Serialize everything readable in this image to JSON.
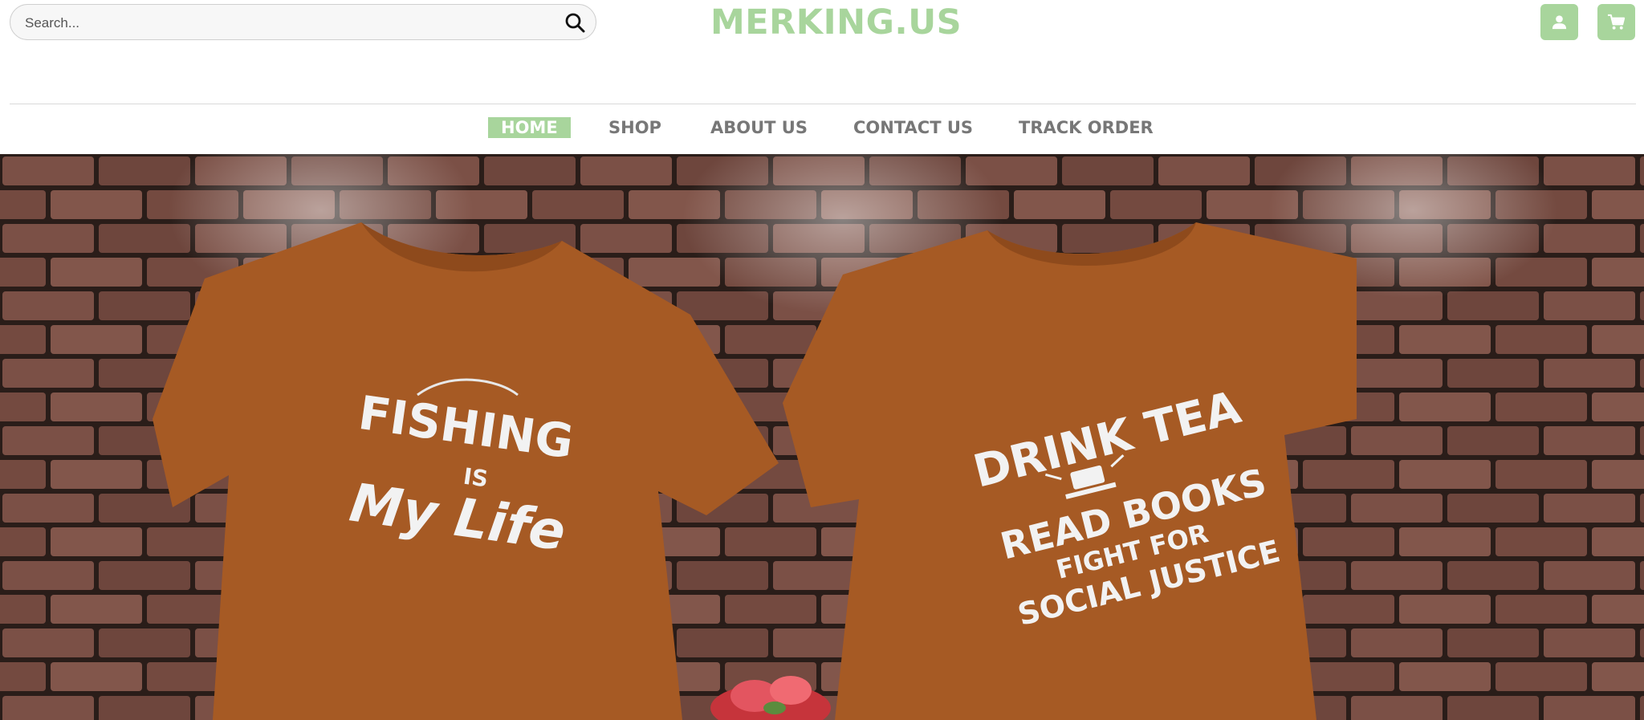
{
  "search": {
    "placeholder": "Search..."
  },
  "brand": {
    "logo": "MERKING.US"
  },
  "nav": {
    "items": [
      {
        "label": "HOME",
        "active": true
      },
      {
        "label": "SHOP",
        "active": false
      },
      {
        "label": "ABOUT US",
        "active": false
      },
      {
        "label": "CONTACT US",
        "active": false
      },
      {
        "label": "TRACK ORDER",
        "active": false
      }
    ]
  },
  "hero": {
    "left_shirt": {
      "line1": "FISHING",
      "line2": "IS",
      "line3": "My Life"
    },
    "right_shirt": {
      "line1": "DRINK TEA",
      "line2": "READ BOOKS",
      "line3": "FIGHT FOR",
      "line4": "SOCIAL JUSTICE"
    }
  },
  "colors": {
    "accent": "#a8d59c",
    "nav_text": "#777777",
    "shirt": "#a65a24",
    "brick": "#7a4e44"
  },
  "icons": {
    "search": "search-icon",
    "account": "user-icon",
    "cart": "cart-icon"
  }
}
